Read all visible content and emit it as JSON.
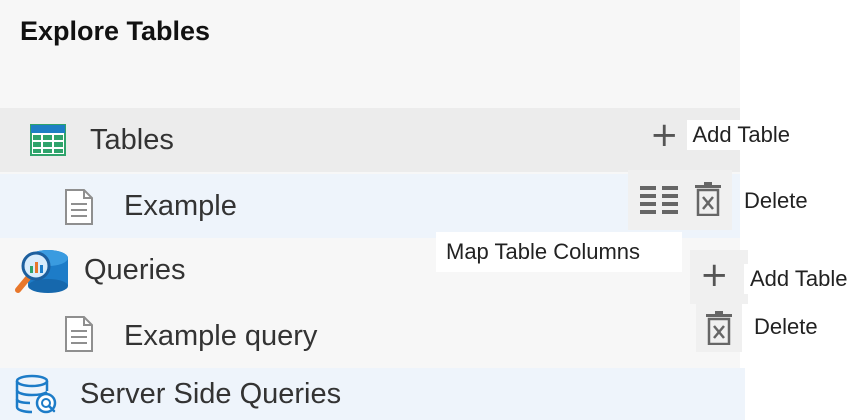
{
  "panel": {
    "title": "Explore Tables"
  },
  "tree": {
    "tables": {
      "label": "Tables",
      "icon": "table-grid-icon"
    },
    "example": {
      "label": "Example",
      "icon": "document-icon"
    },
    "queries": {
      "label": "Queries",
      "icon": "database-search-icon"
    },
    "example_query": {
      "label": "Example query",
      "icon": "document-icon"
    },
    "server_side_queries": {
      "label": "Server Side Queries",
      "icon": "database-search-icon"
    }
  },
  "actions": {
    "tables_add": {
      "icon": "+",
      "label": "Add Table"
    },
    "example_map_icon": "map-columns-icon",
    "example_delete": {
      "label": "Delete",
      "icon": "delete-icon"
    },
    "map_tooltip": "Map Table Columns",
    "queries_add": {
      "icon": "+",
      "label": "Add Table"
    },
    "query_delete": {
      "label": "Delete",
      "icon": "delete-icon"
    }
  },
  "colors": {
    "table_icon_green": "#2fa36b",
    "table_icon_header": "#1e7fc4",
    "db_icon_blue": "#1d7cc8",
    "db_magnifier_orange": "#e8772b",
    "selected_row_bg": "#ececec",
    "hover_row_bg": "#eef4fb"
  }
}
